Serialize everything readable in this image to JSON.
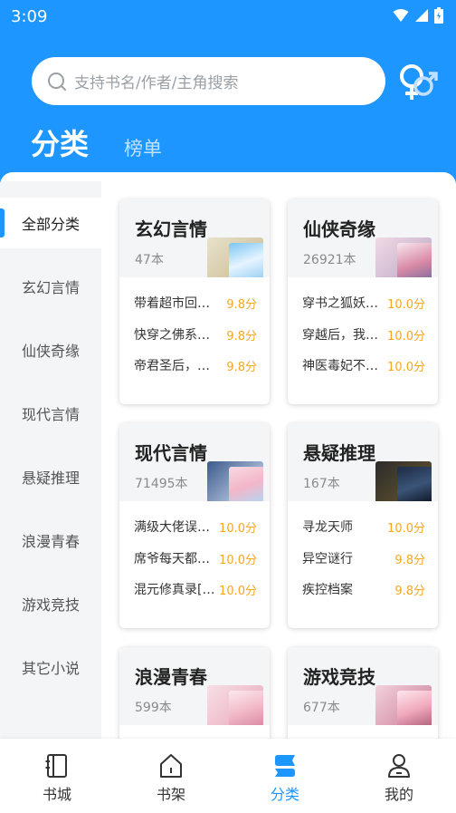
{
  "status_bar": {
    "time": "3:09"
  },
  "search": {
    "placeholder": "支持书名/作者/主角搜索"
  },
  "top_tabs": [
    {
      "label": "分类",
      "active": true
    },
    {
      "label": "榜单",
      "active": false
    }
  ],
  "side_nav": [
    {
      "label": "全部分类",
      "active": true
    },
    {
      "label": "玄幻言情",
      "active": false
    },
    {
      "label": "仙侠奇缘",
      "active": false
    },
    {
      "label": "现代言情",
      "active": false
    },
    {
      "label": "悬疑推理",
      "active": false
    },
    {
      "label": "浪漫青春",
      "active": false
    },
    {
      "label": "游戏竞技",
      "active": false
    },
    {
      "label": "其它小说",
      "active": false
    }
  ],
  "categories": [
    {
      "title": "玄幻言情",
      "count": "47本",
      "books": [
        {
          "name": "带着超市回…",
          "score": "9.8分"
        },
        {
          "name": "快穿之佛系…",
          "score": "9.8分"
        },
        {
          "name": "帝君圣后，…",
          "score": "9.8分"
        }
      ]
    },
    {
      "title": "仙侠奇缘",
      "count": "26921本",
      "books": [
        {
          "name": "穿书之狐妖…",
          "score": "10.0分"
        },
        {
          "name": "穿越后，我…",
          "score": "10.0分"
        },
        {
          "name": "神医毒妃不…",
          "score": "10.0分"
        }
      ]
    },
    {
      "title": "现代言情",
      "count": "71495本",
      "books": [
        {
          "name": "满级大佬误…",
          "score": "10.0分"
        },
        {
          "name": "席爷每天都…",
          "score": "10.0分"
        },
        {
          "name": "混元修真录[…",
          "score": "10.0分"
        }
      ]
    },
    {
      "title": "悬疑推理",
      "count": "167本",
      "books": [
        {
          "name": "寻龙天师",
          "score": "10.0分"
        },
        {
          "name": "异空谜行",
          "score": "9.8分"
        },
        {
          "name": "疾控档案",
          "score": "9.8分"
        }
      ]
    },
    {
      "title": "浪漫青春",
      "count": "599本",
      "books": []
    },
    {
      "title": "游戏竞技",
      "count": "677本",
      "books": []
    }
  ],
  "bottom_tabs": [
    {
      "label": "书城",
      "icon": "bookstore-icon",
      "active": false
    },
    {
      "label": "书架",
      "icon": "bookshelf-icon",
      "active": false
    },
    {
      "label": "分类",
      "icon": "category-icon",
      "active": true
    },
    {
      "label": "我的",
      "icon": "profile-icon",
      "active": false
    }
  ],
  "colors": {
    "primary": "#1e96ff",
    "score": "#f5a623",
    "header_bg": "#1e96ff"
  }
}
